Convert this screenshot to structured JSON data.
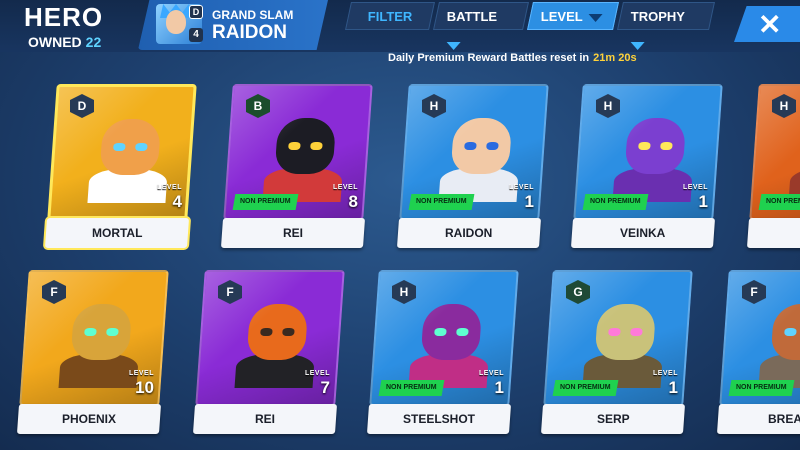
{
  "header": {
    "title": "HERO",
    "owned_label": "OWNED",
    "owned_count": "22"
  },
  "current_hero": {
    "mode": "GRAND SLAM",
    "name": "RAIDON",
    "rank": "D",
    "level": "4"
  },
  "tabs": {
    "filter": "FILTER",
    "battle": "BATTLE",
    "level": "LEVEL",
    "trophy": "TROPHY"
  },
  "reset_note": {
    "text": "Daily Premium Reward Battles reset in",
    "time": "21m 20s"
  },
  "labels": {
    "level": "LEVEL",
    "non_premium": "NON PREMIUM"
  },
  "heroes": [
    {
      "name": "MORTAL",
      "rank": "D",
      "level": "4",
      "non_premium": false,
      "selected": true,
      "bg": "#f2b01c"
    },
    {
      "name": "REI",
      "rank": "B",
      "level": "8",
      "non_premium": true,
      "selected": false,
      "bg": "#8a2bd6"
    },
    {
      "name": "RAIDON",
      "rank": "H",
      "level": "1",
      "non_premium": true,
      "selected": false,
      "bg": "#2c8fe3"
    },
    {
      "name": "VEINKA",
      "rank": "H",
      "level": "1",
      "non_premium": true,
      "selected": false,
      "bg": "#2c8fe3"
    },
    {
      "name": "C",
      "rank": "H",
      "level": "",
      "non_premium": true,
      "selected": false,
      "bg": "#e0621c"
    },
    {
      "name": "PHOENIX",
      "rank": "F",
      "level": "10",
      "non_premium": false,
      "selected": false,
      "bg": "#f2a81c"
    },
    {
      "name": "REI",
      "rank": "F",
      "level": "7",
      "non_premium": false,
      "selected": false,
      "bg": "#8a2bd6"
    },
    {
      "name": "STEELSHOT",
      "rank": "H",
      "level": "1",
      "non_premium": true,
      "selected": false,
      "bg": "#2c8fe3"
    },
    {
      "name": "SERP",
      "rank": "G",
      "level": "1",
      "non_premium": true,
      "selected": false,
      "bg": "#2c8fe3"
    },
    {
      "name": "BREAK",
      "rank": "F",
      "level": "",
      "non_premium": true,
      "selected": false,
      "bg": "#2c8fe3"
    }
  ],
  "colors": {
    "accent_blue": "#2c8fe3",
    "timer_yellow": "#ffd23a",
    "owned_cyan": "#5fd3ff",
    "non_premium_green": "#1fd14f",
    "selected_border": "#ffe85a"
  },
  "icons": {
    "close": "close-icon",
    "dropdown": "chevron-down-icon"
  }
}
